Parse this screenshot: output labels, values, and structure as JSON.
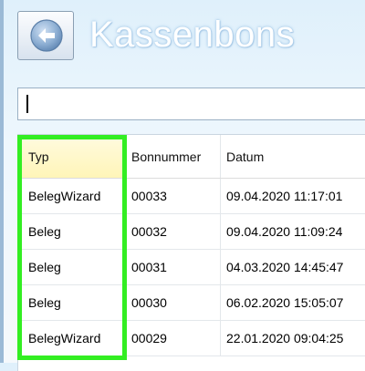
{
  "header": {
    "title": "Kassenbons",
    "back_icon": "arrow-left-icon"
  },
  "search": {
    "value": ""
  },
  "grid": {
    "columns": [
      "Typ",
      "Bonnummer",
      "Datum"
    ],
    "rows": [
      {
        "typ": "BelegWizard",
        "bonnummer": "00033",
        "datum": "09.04.2020 11:17:01"
      },
      {
        "typ": "Beleg",
        "bonnummer": "00032",
        "datum": "09.04.2020 11:09:24"
      },
      {
        "typ": "Beleg",
        "bonnummer": "00031",
        "datum": "04.03.2020 14:45:47"
      },
      {
        "typ": "Beleg",
        "bonnummer": "00030",
        "datum": "06.02.2020 15:05:07"
      },
      {
        "typ": "BelegWizard",
        "bonnummer": "00029",
        "datum": "22.01.2020 09:04:25"
      }
    ]
  },
  "colors": {
    "highlight": "#33ee22",
    "sorted_header": "#fff5b8",
    "title_glow": "#9cc4e6"
  }
}
